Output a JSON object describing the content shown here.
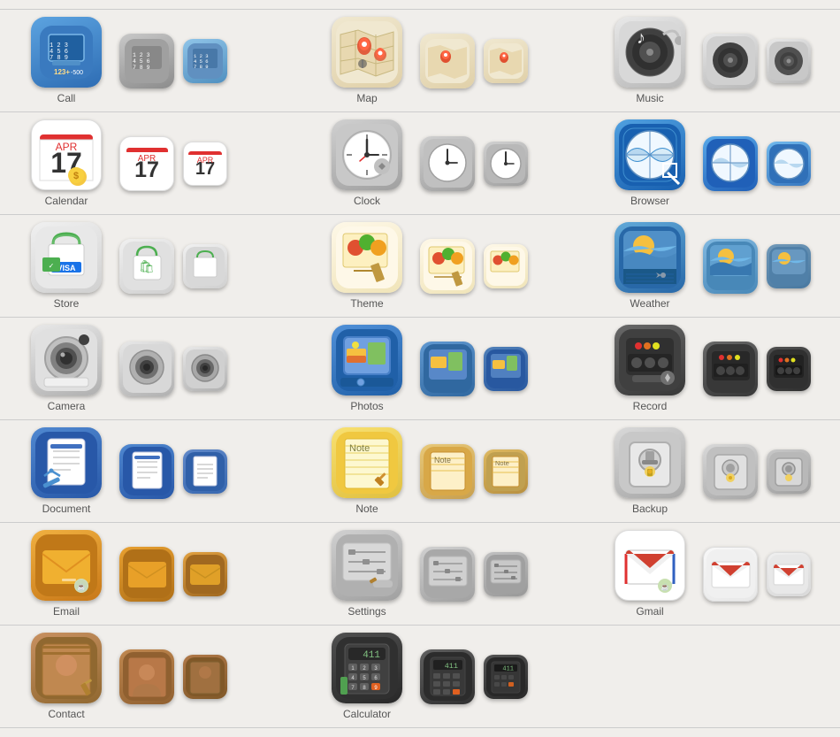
{
  "rows": [
    {
      "id": "call",
      "left": {
        "label": "Call",
        "variants": [
          "call-v1",
          "call-v2",
          "call-v3"
        ]
      },
      "center": {
        "label": "Map",
        "variants": [
          "map-v1",
          "map-v2",
          "map-v3"
        ]
      },
      "right": {
        "label": "Music",
        "variants": [
          "music-v1",
          "music-v2",
          "music-v3"
        ]
      }
    },
    {
      "id": "calendar",
      "left": {
        "label": "Calendar",
        "variants": [
          "cal-v1",
          "cal-v2",
          "cal-v3"
        ]
      },
      "center": {
        "label": "Clock",
        "variants": [
          "clock-v1",
          "clock-v2",
          "clock-v3"
        ]
      },
      "right": {
        "label": "Browser",
        "variants": [
          "browser-v1",
          "browser-v2",
          "browser-v3"
        ]
      }
    },
    {
      "id": "store",
      "left": {
        "label": "Store",
        "variants": [
          "store-v1",
          "store-v2",
          "store-v3"
        ]
      },
      "center": {
        "label": "Theme",
        "variants": [
          "theme-v1",
          "theme-v2",
          "theme-v3"
        ]
      },
      "right": {
        "label": "Weather",
        "variants": [
          "weather-v1",
          "weather-v2",
          "weather-v3"
        ]
      }
    },
    {
      "id": "camera",
      "left": {
        "label": "Camera",
        "variants": [
          "camera-v1",
          "camera-v2",
          "camera-v3"
        ]
      },
      "center": {
        "label": "Photos",
        "variants": [
          "photos-v1",
          "photos-v2",
          "photos-v3"
        ]
      },
      "right": {
        "label": "Record",
        "variants": [
          "record-v1",
          "record-v2",
          "record-v3"
        ]
      }
    },
    {
      "id": "document",
      "left": {
        "label": "Document",
        "variants": [
          "doc-v1",
          "doc-v2",
          "doc-v3"
        ]
      },
      "center": {
        "label": "Note",
        "variants": [
          "note-v1",
          "note-v2",
          "note-v3"
        ]
      },
      "right": {
        "label": "Backup",
        "variants": [
          "backup-v1",
          "backup-v2",
          "backup-v3"
        ]
      }
    },
    {
      "id": "email",
      "left": {
        "label": "Email",
        "variants": [
          "email-v1",
          "email-v2",
          "email-v3"
        ]
      },
      "center": {
        "label": "Settings",
        "variants": [
          "settings-v1",
          "settings-v2",
          "settings-v3"
        ]
      },
      "right": {
        "label": "Gmail",
        "variants": [
          "gmail-v1",
          "gmail-v2",
          "gmail-v3"
        ]
      }
    },
    {
      "id": "contact",
      "left": {
        "label": "Contact",
        "variants": [
          "contact-v1",
          "contact-v2",
          "contact-v3"
        ]
      },
      "center": {
        "label": "Calculator",
        "variants": [
          "calc-v1",
          "calc-v2",
          "calc-v3"
        ]
      },
      "right": {
        "label": "",
        "variants": []
      }
    }
  ]
}
